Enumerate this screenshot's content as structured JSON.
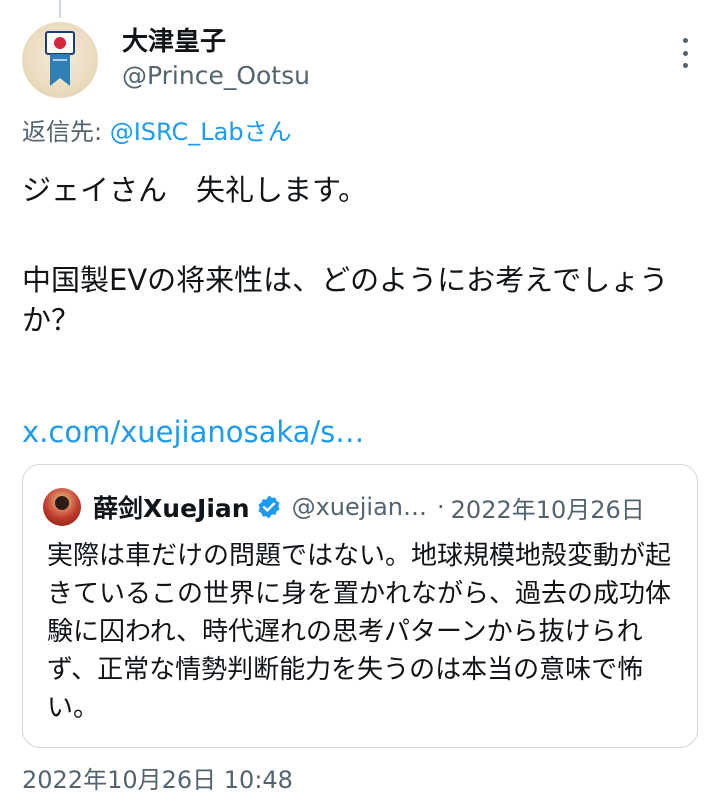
{
  "author": {
    "display_name": "大津皇子",
    "handle": "@Prince_Ootsu",
    "avatar_icon": "pin-badge-icon"
  },
  "reply_to": {
    "prefix": "返信先: ",
    "mention": "@ISRC_Labさん"
  },
  "tweet": {
    "line1": "ジェイさん　失礼します。",
    "line2": "中国製EVの将来性は、どのようにお考えでしょうか？",
    "link": "x.com/xuejianosaka/s…"
  },
  "quoted": {
    "display_name": "薛剑XueJian",
    "handle": "@xuejian…",
    "separator": "·",
    "date": "2022年10月26日",
    "text": "実際は車だけの問題ではない。地球規模地殻変動が起きているこの世界に身を置かれながら、過去の成功体験に囚われ、時代遅れの思考パターンから抜けられず、正常な情勢判断能力を失うのは本当の意味で怖い。"
  },
  "timestamp": "2022年10月26日 10:48",
  "colors": {
    "accent": "#1d9bf0",
    "secondary_text": "#536471",
    "border": "#cfd9de"
  }
}
